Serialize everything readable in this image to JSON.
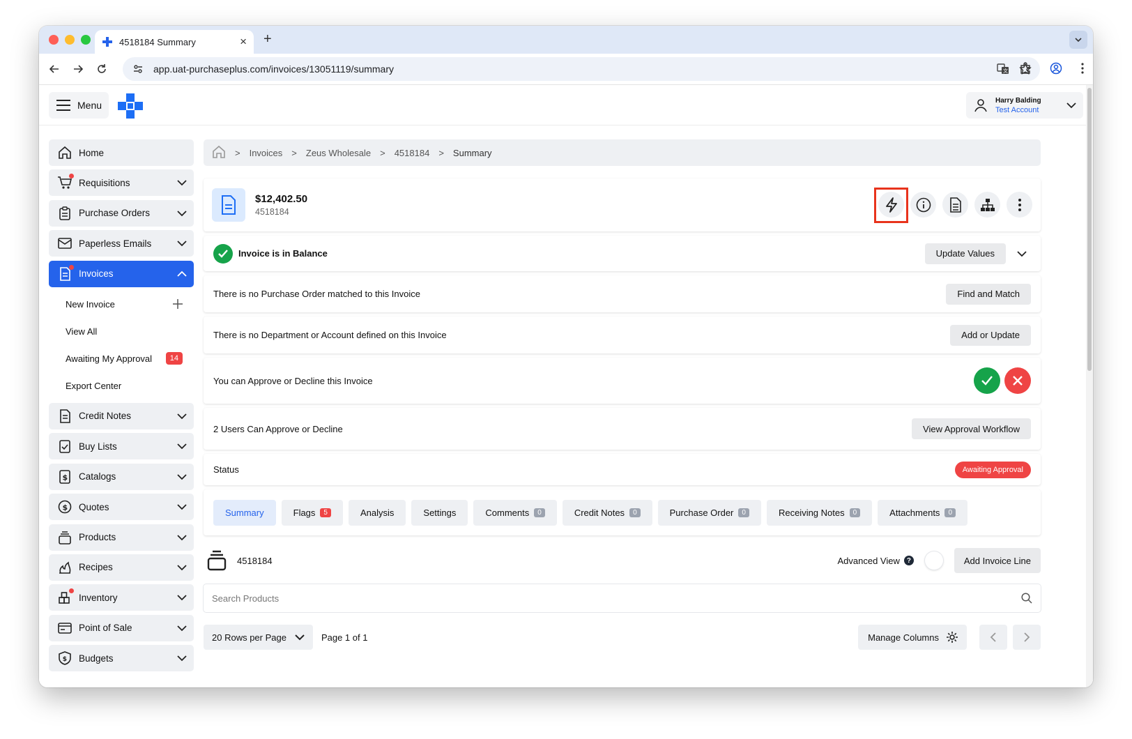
{
  "browser": {
    "tab_title": "4518184 Summary",
    "url": "app.uat-purchaseplus.com/invoices/13051119/summary"
  },
  "header": {
    "menu_label": "Menu",
    "user_name": "Harry Balding",
    "user_account": "Test Account"
  },
  "sidebar": {
    "items": [
      {
        "label": "Home",
        "icon": "home-icon"
      },
      {
        "label": "Requisitions",
        "icon": "cart-icon"
      },
      {
        "label": "Purchase Orders",
        "icon": "clipboard-icon"
      },
      {
        "label": "Paperless Emails",
        "icon": "mail-icon"
      },
      {
        "label": "Invoices",
        "icon": "invoice-icon"
      },
      {
        "label": "Credit Notes",
        "icon": "document-icon"
      },
      {
        "label": "Buy Lists",
        "icon": "checklist-icon"
      },
      {
        "label": "Catalogs",
        "icon": "catalog-icon"
      },
      {
        "label": "Quotes",
        "icon": "dollar-circle-icon"
      },
      {
        "label": "Products",
        "icon": "box-stack-icon"
      },
      {
        "label": "Recipes",
        "icon": "fire-icon"
      },
      {
        "label": "Inventory",
        "icon": "inventory-icon"
      },
      {
        "label": "Point of Sale",
        "icon": "card-icon"
      },
      {
        "label": "Budgets",
        "icon": "shield-dollar-icon"
      }
    ],
    "invoices_sub": [
      {
        "label": "New Invoice"
      },
      {
        "label": "View All"
      },
      {
        "label": "Awaiting My Approval",
        "badge": "14"
      },
      {
        "label": "Export Center"
      }
    ]
  },
  "breadcrumb": [
    "Invoices",
    "Zeus Wholesale",
    "4518184",
    "Summary"
  ],
  "invoice": {
    "amount": "$12,402.50",
    "number": "4518184"
  },
  "rows": {
    "balance_text": "Invoice is in Balance",
    "update_values_label": "Update Values",
    "po_text": "There is no Purchase Order matched to this Invoice",
    "find_match_label": "Find and Match",
    "dept_text": "There is no Department or Account defined on this Invoice",
    "add_update_label": "Add or Update",
    "approve_text": "You can Approve or Decline this Invoice",
    "users_text": "2 Users Can Approve or Decline",
    "workflow_label": "View Approval Workflow",
    "status_label": "Status",
    "status_value": "Awaiting Approval"
  },
  "tabs": [
    {
      "label": "Summary",
      "count": null
    },
    {
      "label": "Flags",
      "count": "5"
    },
    {
      "label": "Analysis",
      "count": null
    },
    {
      "label": "Settings",
      "count": null
    },
    {
      "label": "Comments",
      "count": "0"
    },
    {
      "label": "Credit Notes",
      "count": "0"
    },
    {
      "label": "Purchase Order",
      "count": "0"
    },
    {
      "label": "Receiving Notes",
      "count": "0"
    },
    {
      "label": "Attachments",
      "count": "0"
    }
  ],
  "lines": {
    "title": "4518184",
    "advanced_view_label": "Advanced View",
    "add_line_label": "Add Invoice Line",
    "search_placeholder": "Search Products",
    "rows_per_page": "20 Rows per Page",
    "page_info": "Page 1 of 1",
    "manage_columns_label": "Manage Columns"
  },
  "colors": {
    "primary": "#2563eb",
    "danger": "#ef4444",
    "success": "#16a34a",
    "highlight": "#e8331c"
  }
}
